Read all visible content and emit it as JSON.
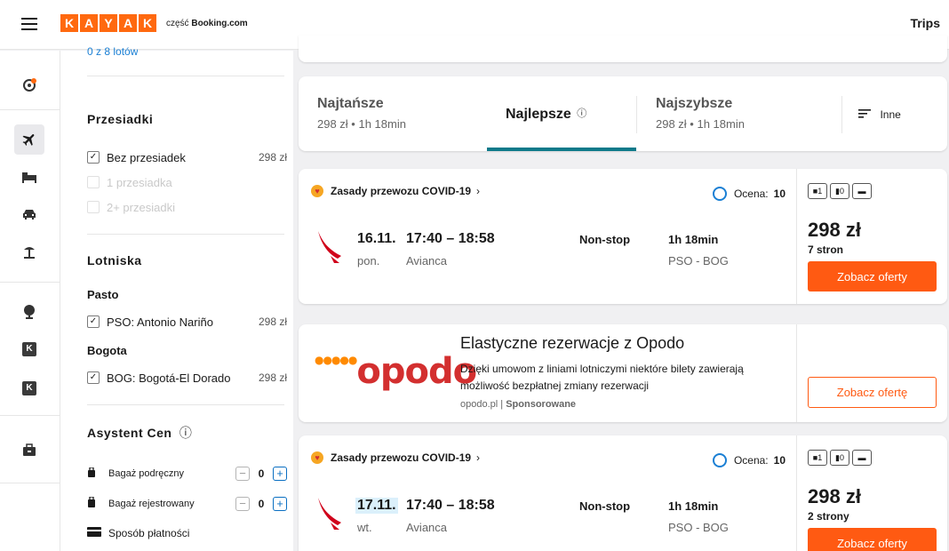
{
  "header": {
    "logo_letters": [
      "K",
      "A",
      "Y",
      "A",
      "K"
    ],
    "logo_prefix": "część",
    "logo_brand": "Booking.com",
    "trips_label": "Trips"
  },
  "rail": {
    "items": [
      {
        "name": "trips-icon",
        "glyph": "◉"
      },
      {
        "name": "flights-icon",
        "glyph": "✈"
      },
      {
        "name": "hotels-icon",
        "glyph": "▬"
      },
      {
        "name": "cars-icon",
        "glyph": "🚗"
      },
      {
        "name": "packages-icon",
        "glyph": "⛱"
      },
      {
        "name": "explore-icon",
        "glyph": "◍"
      },
      {
        "name": "kayak-icon",
        "glyph": "K"
      },
      {
        "name": "kayak-icon-2",
        "glyph": "K"
      },
      {
        "name": "business-icon",
        "glyph": "▣"
      }
    ]
  },
  "filters": {
    "top_cut_text": "0 z 8 lotów",
    "stops": {
      "title": "Przesiadki",
      "options": [
        {
          "label": "Bez przesiadek",
          "price": "298 zł",
          "checked": true,
          "disabled": false
        },
        {
          "label": "1 przesiadka",
          "price": "",
          "checked": false,
          "disabled": true
        },
        {
          "label": "2+ przesiadki",
          "price": "",
          "checked": false,
          "disabled": true
        }
      ]
    },
    "airports": {
      "title": "Lotniska",
      "groups": [
        {
          "city": "Pasto",
          "label": "PSO: Antonio Nariño",
          "price": "298 zł",
          "checked": true
        },
        {
          "city": "Bogota",
          "label": "BOG: Bogotá-El Dorado",
          "price": "298 zł",
          "checked": true
        }
      ]
    },
    "assistant": {
      "title": "Asystent Cen",
      "info_icon": "ⓘ",
      "carry_on": {
        "label": "Bagaż podręczny",
        "count": "0"
      },
      "checked_bag": {
        "label": "Bagaż rejestrowany",
        "count": "0"
      },
      "payment": {
        "label": "Sposób płatności"
      }
    }
  },
  "tabs": [
    {
      "title": "Najtańsze",
      "sub": "298 zł • 1h 18min",
      "active": false
    },
    {
      "title": "Najlepsze",
      "info": "ⓘ",
      "sub": "",
      "active": true
    },
    {
      "title": "Najszybsze",
      "sub": "298 zł • 1h 18min",
      "active": false
    },
    {
      "title": "Inne",
      "sub": "",
      "active": false
    }
  ],
  "results": [
    {
      "covid": "Zasady przewozu COVID-19",
      "rating_label": "Ocena:",
      "rating_value": "10",
      "date": "16.11.",
      "weekday": "pon.",
      "times": "17:40 – 18:58",
      "carrier": "Avianca",
      "stops": "Non-stop",
      "duration": "1h 18min",
      "route": "PSO - BOG",
      "bags": [
        "1",
        "0",
        "▬"
      ],
      "price": "298 zł",
      "sites": "7 stron",
      "button": "Zobacz oferty"
    },
    {
      "covid": "Zasady przewozu COVID-19",
      "rating_label": "Ocena:",
      "rating_value": "10",
      "date": "17.11.",
      "weekday": "wt.",
      "times": "17:40 – 18:58",
      "carrier": "Avianca",
      "stops": "Non-stop",
      "duration": "1h 18min",
      "route": "PSO - BOG",
      "bags": [
        "1",
        "0",
        "▬"
      ],
      "price": "298 zł",
      "sites": "2 strony",
      "button": "Zobacz oferty"
    }
  ],
  "ad": {
    "logo": "opodo",
    "title": "Elastyczne rezerwacje z Opodo",
    "desc": "Dzięki umowom z liniami lotniczymi niektóre bilety zawierają możliwość bezpłatnej zmiany rezerwacji",
    "source": "opodo.pl",
    "sponsored": "Sponsorowane",
    "button": "Zobacz ofertę"
  },
  "colors": {
    "brand": "#ff690f",
    "cta": "#ff5a12",
    "active_tab": "#0e7a8a",
    "rating_ring": "#1a7fd4"
  }
}
